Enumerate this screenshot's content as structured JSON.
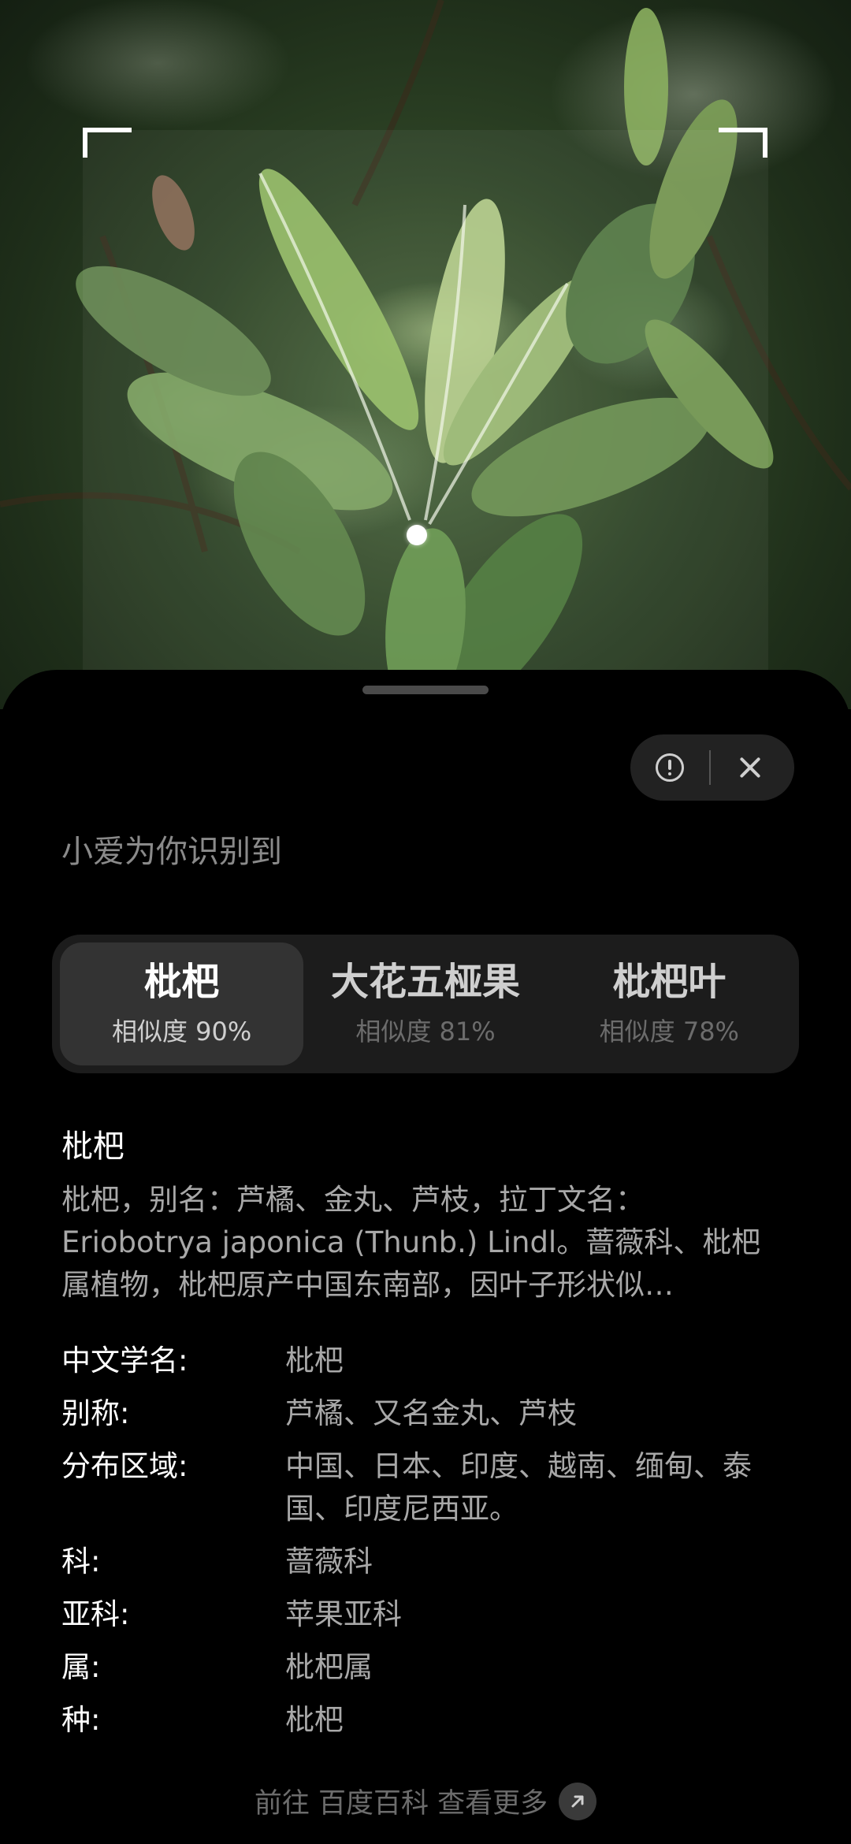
{
  "camera": {
    "scan_frame": "viewfinder"
  },
  "sheet": {
    "subtitle": "小爱为你识别到",
    "tabs": [
      {
        "name": "枇杷",
        "similarity": "相似度 90%",
        "active": true
      },
      {
        "name": "大花五桠果",
        "similarity": "相似度 81%",
        "active": false
      },
      {
        "name": "枇杷叶",
        "similarity": "相似度 78%",
        "active": false
      }
    ],
    "detail": {
      "title": "枇杷",
      "description": "枇杷，别名：芦橘、金丸、芦枝，拉丁文名：Eriobotrya japonica (Thunb.) Lindl。蔷薇科、枇杷属植物，枇杷原产中国东南部，因叶子形状似…"
    },
    "info": [
      {
        "key": "中文学名:",
        "value": "枇杷"
      },
      {
        "key": "别称:",
        "value": "芦橘、又名金丸、芦枝"
      },
      {
        "key": "分布区域:",
        "value": "中国、日本、印度、越南、缅甸、泰国、印度尼西亚。"
      },
      {
        "key": "科:",
        "value": "蔷薇科"
      },
      {
        "key": "亚科:",
        "value": "苹果亚科"
      },
      {
        "key": "属:",
        "value": "枇杷属"
      },
      {
        "key": "种:",
        "value": "枇杷"
      }
    ],
    "footer": "前往 百度百科 查看更多"
  },
  "icons": {
    "feedback": "alert-circle-icon",
    "close": "close-icon",
    "link": "arrow-up-right-icon"
  }
}
